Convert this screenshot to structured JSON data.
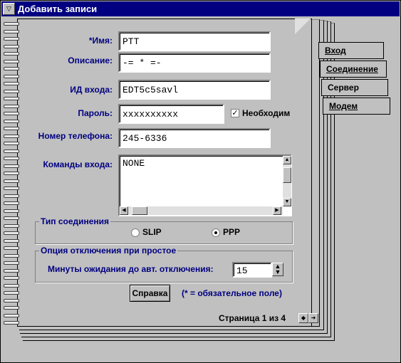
{
  "window": {
    "title": "Добавить записи",
    "sysmenu_glyph": "▽"
  },
  "form": {
    "name_label": "*Имя:",
    "name_value": "PTT",
    "description_label": "Описание:",
    "description_value": "-= * =-",
    "login_id_label": "ИД входа:",
    "login_id_value": "EDT5c5savl",
    "password_label": "Пароль:",
    "password_value": "xxxxxxxxxx",
    "required_checkbox_label": "Необходим",
    "required_checked": true,
    "phone_label": "Номер телефона:",
    "phone_value": "245-6336",
    "login_commands_label": "Команды входа:",
    "login_commands_value": "NONE"
  },
  "connection_type": {
    "title": "Тип соединения",
    "options": [
      "SLIP",
      "PPP"
    ],
    "selected": "PPP"
  },
  "idle": {
    "title": "Опция отключения при простое",
    "minutes_label": "Минуты ожидания до авт. отключения:",
    "minutes_value": "15"
  },
  "help_button": "Справка",
  "required_note": "(* = обязательное поле)",
  "pagination": {
    "text": "Страница 1 из 4"
  },
  "tabs": [
    {
      "label": "Вход"
    },
    {
      "label": "Соединение"
    },
    {
      "label": "Сервер"
    },
    {
      "label": "Модем"
    }
  ]
}
